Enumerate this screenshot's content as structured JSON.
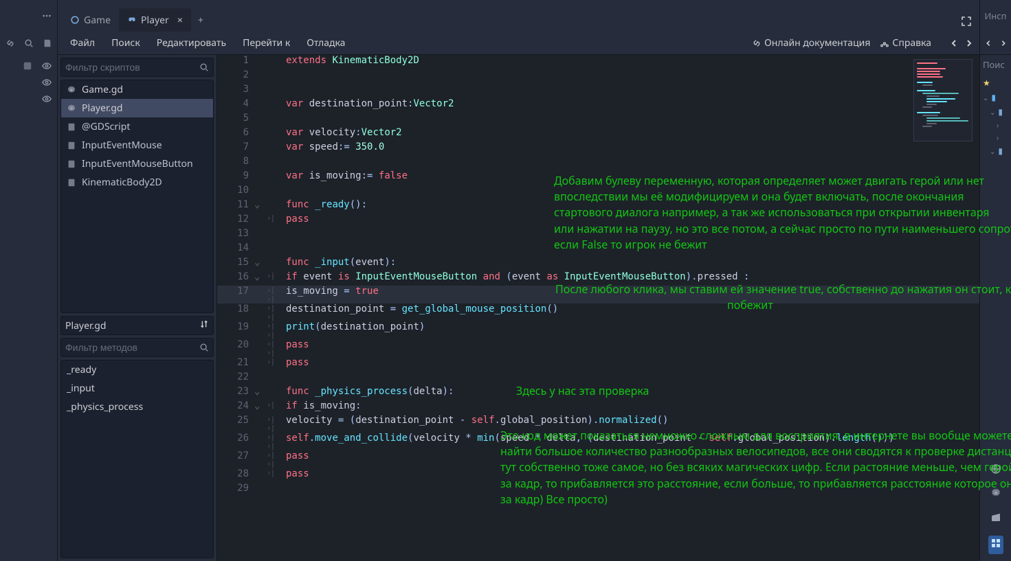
{
  "tabs": {
    "game": "Game",
    "player": "Player"
  },
  "menu": {
    "file": "Файл",
    "search": "Поиск",
    "edit": "Редактировать",
    "goto": "Перейти к",
    "debug": "Отладка",
    "online_docs": "Онлайн документация",
    "help": "Справка"
  },
  "filters": {
    "scripts_ph": "Фильтр скриптов",
    "methods_ph": "Фильтр методов"
  },
  "scripts": {
    "game": "Game.gd",
    "player": "Player.gd",
    "gdscript": "@GDScript",
    "input_mouse": "InputEventMouse",
    "input_mouse_button": "InputEventMouseButton",
    "kinematic": "KinematicBody2D"
  },
  "current_script": "Player.gd",
  "methods": {
    "ready": "_ready",
    "input": "_input",
    "physics": "_physics_process"
  },
  "right_panel": {
    "title": "Инсп",
    "search": "Поис"
  },
  "chart_data": null,
  "code": {
    "l1": {
      "extends": "extends",
      "kinematic": "KinematicBody2D"
    },
    "l4": {
      "var": "var",
      "name": "destination_point",
      "vec2": "Vector2"
    },
    "l6": {
      "var": "var",
      "name": "velocity",
      "vec2": "Vector2"
    },
    "l7": {
      "var": "var",
      "name": "speed",
      "val": "350.0"
    },
    "l9": {
      "var": "var",
      "name": "is_moving",
      "val": "false"
    },
    "l11": {
      "func": "func",
      "name": "_ready"
    },
    "l12": {
      "pass": "pass"
    },
    "l15": {
      "func": "func",
      "name": "_input",
      "arg": "event"
    },
    "l16": {
      "if": "if",
      "event": "event",
      "is": "is",
      "iemb": "InputEventMouseButton",
      "and": "and",
      "as": "as",
      "pressed": "pressed"
    },
    "l17": {
      "name": "is_moving",
      "val": "true"
    },
    "l18": {
      "name": "destination_point",
      "fn": "get_global_mouse_position"
    },
    "l19": {
      "print": "print",
      "arg": "destination_point"
    },
    "l20": {
      "pass": "pass"
    },
    "l21": {
      "pass": "pass"
    },
    "l23": {
      "func": "func",
      "name": "_physics_process",
      "arg": "delta"
    },
    "l24": {
      "if": "if",
      "name": "is_moving"
    },
    "l25": {
      "vel": "velocity",
      "dp": "destination_point",
      "self": "self",
      "gp": "global_position",
      "norm": "normalized"
    },
    "l26": {
      "self": "self",
      "mac": "move_and_collide",
      "vel": "velocity",
      "min": "min",
      "speed": "speed",
      "delta": "delta",
      "dp": "destination_point",
      "gp": "global_position",
      "length": "length"
    },
    "l27": {
      "pass": "pass"
    },
    "l28": {
      "pass": "pass"
    }
  },
  "annotations": {
    "a1_l1": "Добавим булеву переменную, которая определяет может двигать герой или нет",
    "a1_l2": "впоследствии мы её модифицируем и она будет включать, после окончания",
    "a1_l3": "стартового диалога например, а так же использоваться при открытии инвентаря",
    "a1_l4": "или нажатии на паузу, но это все потом, а сейчас просто по пути наименьшего сопротивления",
    "a1_l5": "если False то игрок не бежит",
    "a2_l1": "После любого клика, мы ставим ей значение true, собственно до нажатия он стоит, кликнули",
    "a2_l2": "побежит",
    "a3": "Здесь у нас эта проверка",
    "a4_l1": "Это код может показаться немножко сложным для восприятия, в интернете вы вообще можете",
    "a4_l2": "найти большое количество разнообразных велосипедов, все они сводятся к проверке дистанции до цели",
    "a4_l3": "тут собственно тоже самое, но без всяких магических цифр. Если растояние меньше, чем герой пробегает",
    "a4_l4": "за кадр, то прибавляется это расстояние, если больше, то прибавляется расстояние которое он пробегает",
    "a4_l5": "за кадр) Все просто)"
  }
}
